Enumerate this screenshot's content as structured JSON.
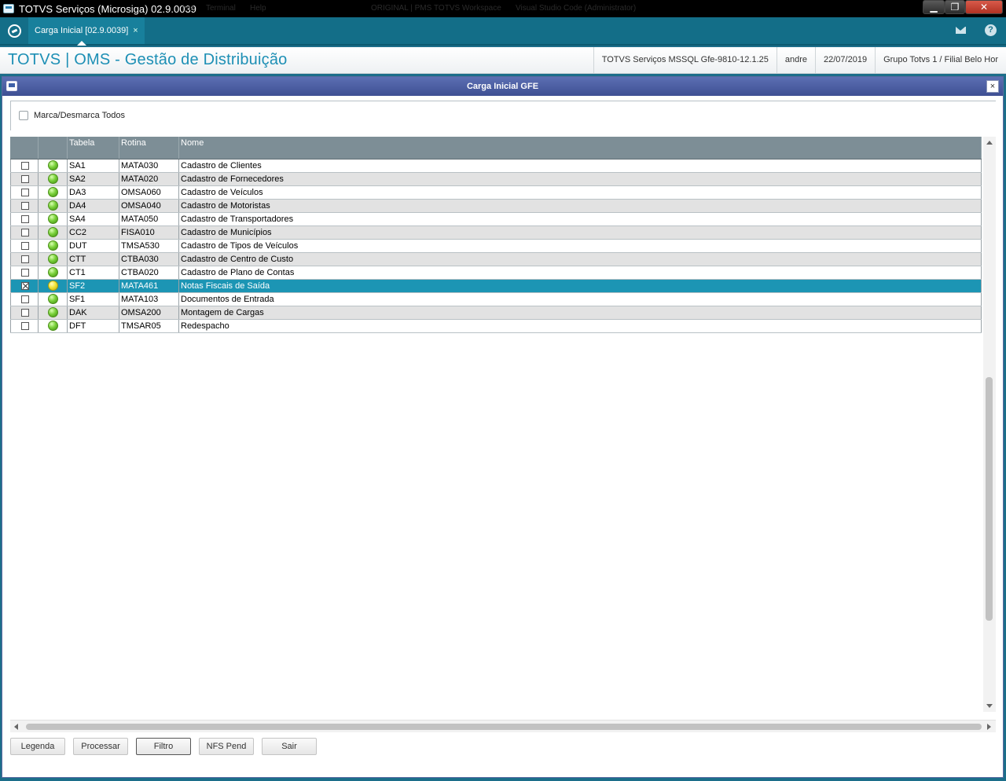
{
  "window": {
    "title": "TOTVS Serviços (Microsiga) 02.9.0039",
    "ghost_menu": [
      "ima",
      "Terminal",
      "Help"
    ],
    "ghost_tasks": [
      "ORIGINAL | PMS",
      "TOTVS Workspace",
      "Visual Studio Code (Administrator)"
    ],
    "minimize_label": "▁",
    "maximize_label": "❐",
    "close_label": "✕"
  },
  "tabbar": {
    "tab_label": "Carga Inicial [02.9.0039]",
    "tab_close": "×"
  },
  "module": {
    "title": "TOTVS | OMS - Gestão de Distribuição",
    "environment": "TOTVS Serviços MSSQL Gfe-9810-12.1.25",
    "user": "andre",
    "date": "22/07/2019",
    "company": "Grupo Totvs 1 / Filial Belo Hor"
  },
  "dialog": {
    "title": "Carga Inicial GFE",
    "close_label": "×",
    "select_all_label": "Marca/Desmarca Todos",
    "columns": {
      "tabela": "Tabela",
      "rotina": "Rotina",
      "nome": "Nome"
    },
    "rows": [
      {
        "checked": false,
        "status": "green",
        "tabela": "SA1",
        "rotina": "MATA030",
        "nome": "Cadastro de Clientes"
      },
      {
        "checked": false,
        "status": "green",
        "tabela": "SA2",
        "rotina": "MATA020",
        "nome": "Cadastro de Fornecedores"
      },
      {
        "checked": false,
        "status": "green",
        "tabela": "DA3",
        "rotina": "OMSA060",
        "nome": "Cadastro de Veículos"
      },
      {
        "checked": false,
        "status": "green",
        "tabela": "DA4",
        "rotina": "OMSA040",
        "nome": "Cadastro de Motoristas"
      },
      {
        "checked": false,
        "status": "green",
        "tabela": "SA4",
        "rotina": "MATA050",
        "nome": "Cadastro de Transportadores"
      },
      {
        "checked": false,
        "status": "green",
        "tabela": "CC2",
        "rotina": "FISA010",
        "nome": "Cadastro de Municípios"
      },
      {
        "checked": false,
        "status": "green",
        "tabela": "DUT",
        "rotina": "TMSA530",
        "nome": "Cadastro de Tipos de Veículos"
      },
      {
        "checked": false,
        "status": "green",
        "tabela": "CTT",
        "rotina": "CTBA030",
        "nome": "Cadastro de Centro de Custo"
      },
      {
        "checked": false,
        "status": "green",
        "tabela": "CT1",
        "rotina": "CTBA020",
        "nome": "Cadastro de Plano de Contas"
      },
      {
        "checked": true,
        "status": "yellow",
        "tabela": "SF2",
        "rotina": "MATA461",
        "nome": "Notas Fiscais de Saída",
        "selected": true
      },
      {
        "checked": false,
        "status": "green",
        "tabela": "SF1",
        "rotina": "MATA103",
        "nome": "Documentos de Entrada"
      },
      {
        "checked": false,
        "status": "green",
        "tabela": "DAK",
        "rotina": "OMSA200",
        "nome": "Montagem de Cargas"
      },
      {
        "checked": false,
        "status": "green",
        "tabela": "DFT",
        "rotina": "TMSAR05",
        "nome": "Redespacho"
      }
    ],
    "buttons": {
      "legenda": "Legenda",
      "processar": "Processar",
      "filtro": "Filtro",
      "nfs_pend": "NFS Pend",
      "sair": "Sair"
    }
  },
  "colors": {
    "accent": "#1d8fb5",
    "tabbar": "#136e88",
    "dialog_title": "#4b5ea3",
    "selected_row": "#1c95b4",
    "grid_header": "#7d8e96"
  }
}
